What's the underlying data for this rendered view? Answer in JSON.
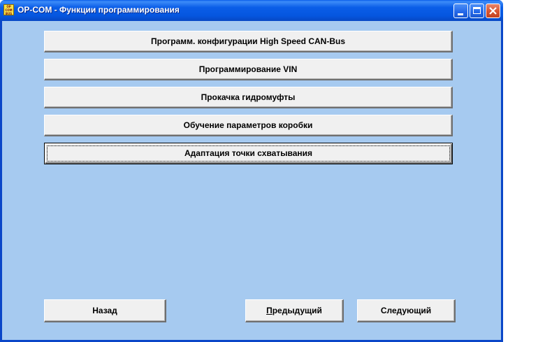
{
  "window": {
    "title": "OP-COM - Функции программирования",
    "icon_text": [
      "OP",
      "COM",
      "BUS"
    ]
  },
  "titlebar_buttons": {
    "minimize": "minimize-icon",
    "maximize": "maximize-icon",
    "close": "close-icon"
  },
  "menu": {
    "items": [
      {
        "label": "Программ. конфигурации High Speed CAN-Bus"
      },
      {
        "label": "Программирование VIN"
      },
      {
        "label": "Прокачка гидромуфты"
      },
      {
        "label": "Обучение параметров коробки"
      },
      {
        "label": "Адаптация точки схватывания"
      }
    ]
  },
  "nav": {
    "back": "Назад",
    "previous_mnemonic": "П",
    "previous_rest": "редыдущий",
    "next": "Следующий"
  },
  "colors": {
    "client_background": "#a6caf0",
    "titlebar": "#0a52d8",
    "button_face": "#f0f0f0"
  }
}
